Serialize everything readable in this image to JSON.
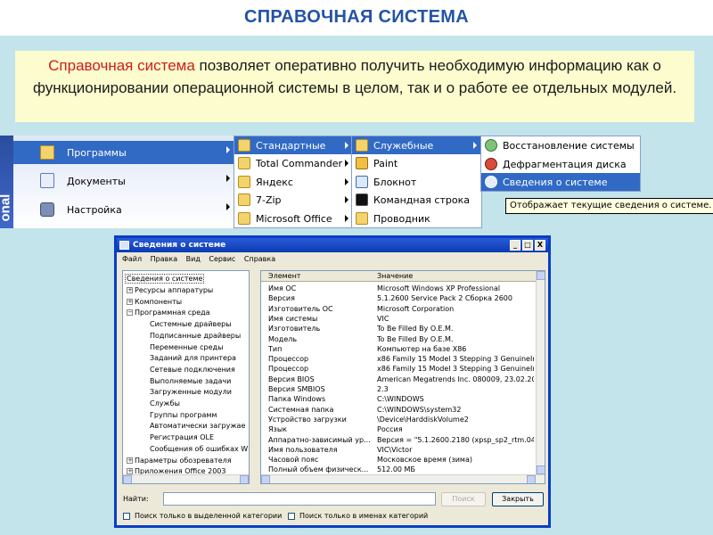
{
  "slide": {
    "title": "СПРАВОЧНАЯ СИСТЕМА",
    "note_highlight": "Справочная система",
    "note_rest": " позволяет оперативно получить необходимую информацию как о функционировании операционной системы в целом, так и о работе ее отдельных модулей."
  },
  "start_menu": {
    "strip_text": "onal",
    "main_items": [
      "Программы",
      "Документы",
      "Настройка"
    ],
    "programs_items": [
      "Стандартные",
      "Total Commander",
      "Яндекс",
      "7-Zip",
      "Microsoft Office"
    ],
    "accessories_items": [
      "Служебные",
      "Paint",
      "Блокнот",
      "Командная строка",
      "Проводник"
    ],
    "system_tools_items": [
      "Восстановление системы",
      "Дефрагментация диска",
      "Сведения о системе"
    ],
    "tooltip": "Отображает текущие сведения о системе."
  },
  "window": {
    "title": "Сведения о системе",
    "menu": [
      "Файл",
      "Правка",
      "Вид",
      "Сервис",
      "Справка"
    ],
    "title_buttons": [
      "_",
      "□",
      "X"
    ],
    "tree": {
      "root": "Сведения о системе",
      "items": [
        {
          "label": "Ресурсы аппаратуры",
          "level": 1,
          "toggle": "+"
        },
        {
          "label": "Компоненты",
          "level": 1,
          "toggle": "+"
        },
        {
          "label": "Программная среда",
          "level": 1,
          "toggle": "−"
        },
        {
          "label": "Системные драйверы",
          "level": 2,
          "toggle": ""
        },
        {
          "label": "Подписанные драйверы",
          "level": 2,
          "toggle": ""
        },
        {
          "label": "Переменные среды",
          "level": 2,
          "toggle": ""
        },
        {
          "label": "Заданий для принтера",
          "level": 2,
          "toggle": ""
        },
        {
          "label": "Сетевые подключения",
          "level": 2,
          "toggle": ""
        },
        {
          "label": "Выполняемые задачи",
          "level": 2,
          "toggle": ""
        },
        {
          "label": "Загруженные модули",
          "level": 2,
          "toggle": ""
        },
        {
          "label": "Службы",
          "level": 2,
          "toggle": ""
        },
        {
          "label": "Группы программ",
          "level": 2,
          "toggle": ""
        },
        {
          "label": "Автоматически загружае",
          "level": 2,
          "toggle": ""
        },
        {
          "label": "Регистрация OLE",
          "level": 2,
          "toggle": ""
        },
        {
          "label": "Сообщения об ошибках W",
          "level": 2,
          "toggle": ""
        },
        {
          "label": "Параметры обозревателя",
          "level": 1,
          "toggle": "+"
        },
        {
          "label": "Приложения Office 2003",
          "level": 1,
          "toggle": "+"
        }
      ]
    },
    "table": {
      "headers": [
        "Элемент",
        "Значение"
      ],
      "rows": [
        [
          "Имя ОС",
          "Microsoft Windows XP Professional"
        ],
        [
          "Версия",
          "5.1.2600 Service Pack 2 Сборка 2600"
        ],
        [
          "Изготовитель ОС",
          "Microsoft Corporation"
        ],
        [
          "Имя системы",
          "VIC"
        ],
        [
          "Изготовитель",
          "To Be Filled By O.E.M."
        ],
        [
          "Модель",
          "To Be Filled By O.E.M."
        ],
        [
          "Тип",
          "Компьютер на базе X86"
        ],
        [
          "Процессор",
          "x86 Family 15 Model 3 Stepping 3 GenuineInt"
        ],
        [
          "Процессор",
          "x86 Family 15 Model 3 Stepping 3 GenuineInt"
        ],
        [
          "Версия BIOS",
          "American Megatrends Inc. 080009, 23.02.200"
        ],
        [
          "Версия SMBIOS",
          "2.3"
        ],
        [
          "Папка Windows",
          "C:\\WINDOWS"
        ],
        [
          "Системная папка",
          "C:\\WINDOWS\\system32"
        ],
        [
          "Устройство загрузки",
          "\\Device\\HarddiskVolume2"
        ],
        [
          "Язык",
          "Россия"
        ],
        [
          "Аппаратно-зависимый ур...",
          "Версия = \"5.1.2600.2180 (xpsp_sp2_rtm.040"
        ],
        [
          "Имя пользователя",
          "VIC\\Victor"
        ],
        [
          "Часовой пояс",
          "Московское время (зима)"
        ],
        [
          "Полный объем физическ...",
          "512.00 МБ"
        ]
      ]
    },
    "find_label": "Найти:",
    "find_value": "",
    "search_button": "Поиск",
    "close_button": "Закрыть",
    "checkbox_selected_category": "Поиск только в выделенной категории",
    "checkbox_category_names": "Поиск только в именах категорий"
  },
  "colors": {
    "title_blue": "#2453a6",
    "background": "#c2e4ea",
    "note_background": "#fcfcce",
    "highlight_red": "#d11c1c",
    "menu_selection": "#316ac5",
    "window_frame": "#0a3ec4"
  },
  "icons": {
    "programs": "programs-folder-icon",
    "documents": "documents-icon",
    "settings": "settings-icon",
    "folder": "program-group-icon",
    "paint": "paint-icon",
    "notepad": "notepad-icon",
    "cmd": "command-prompt-icon",
    "explorer": "explorer-icon",
    "restore": "system-restore-icon",
    "defrag": "defrag-icon",
    "sysinfo": "system-info-icon"
  }
}
